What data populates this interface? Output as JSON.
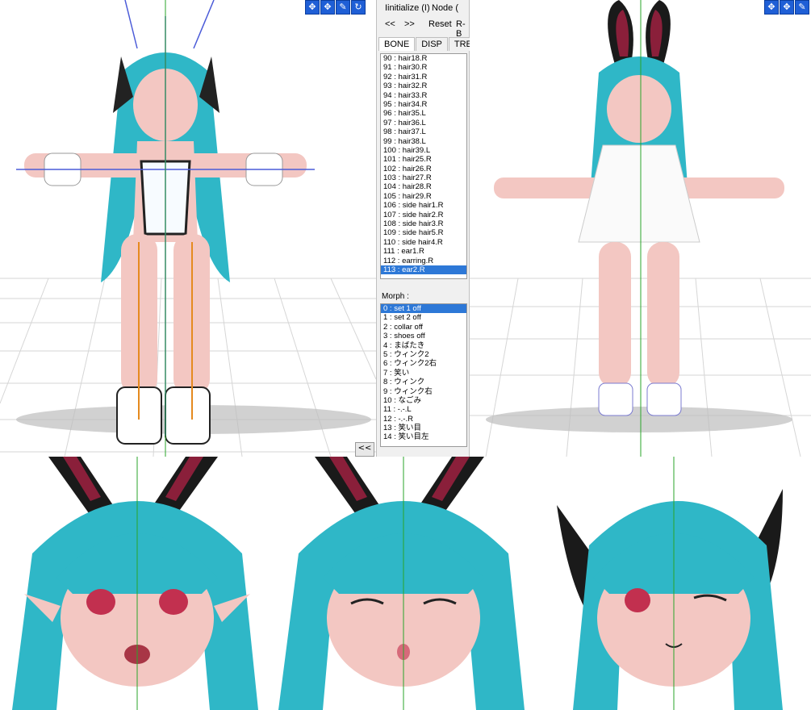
{
  "menu": {
    "initialize": "Iinitialize (I)",
    "node": "Node ("
  },
  "nav": {
    "prev": "<<",
    "next": ">>",
    "reset": "Reset",
    "rb": "R-B"
  },
  "tabs": [
    "BONE",
    "DISP",
    "TREE"
  ],
  "bones": [
    "90 : hair18.R",
    "91 : hair30.R",
    "92 : hair31.R",
    "93 : hair32.R",
    "94 : hair33.R",
    "95 : hair34.R",
    "96 : hair35.L",
    "97 : hair36.L",
    "98 : hair37.L",
    "99 : hair38.L",
    "100 : hair39.L",
    "101 : hair25.R",
    "102 : hair26.R",
    "103 : hair27.R",
    "104 : hair28.R",
    "105 : hair29.R",
    "106 : side hair1.R",
    "107 : side hair2.R",
    "108 : side hair3.R",
    "109 : side hair5.R",
    "110 : side hair4.R",
    "111 : ear1.R",
    "112 : earring.R",
    "113 : ear2.R"
  ],
  "morph_label": "Morph :",
  "morphs": [
    "0 : set 1 off",
    "1 : set 2 off",
    "2 : collar off",
    "3 : shoes off",
    "4 : まばたき",
    "5 : ウィンク2",
    "6 : ウィンク2右",
    "7 : 笑い",
    "8 : ウィンク",
    "9 : ウィンク右",
    "10 : なごみ",
    "11 : -.-.L",
    "12 : -.-.R",
    "13 : 笑い目",
    "14 : 笑い目左"
  ],
  "collapse": "<<",
  "colors": {
    "hair": "#2fb7c7",
    "skin": "#f3c7c2",
    "selection": "#2d78d7",
    "ear": "#8a1f3a"
  },
  "icons": [
    "move-icon",
    "rotate-icon",
    "pen-icon",
    "refresh-icon"
  ]
}
